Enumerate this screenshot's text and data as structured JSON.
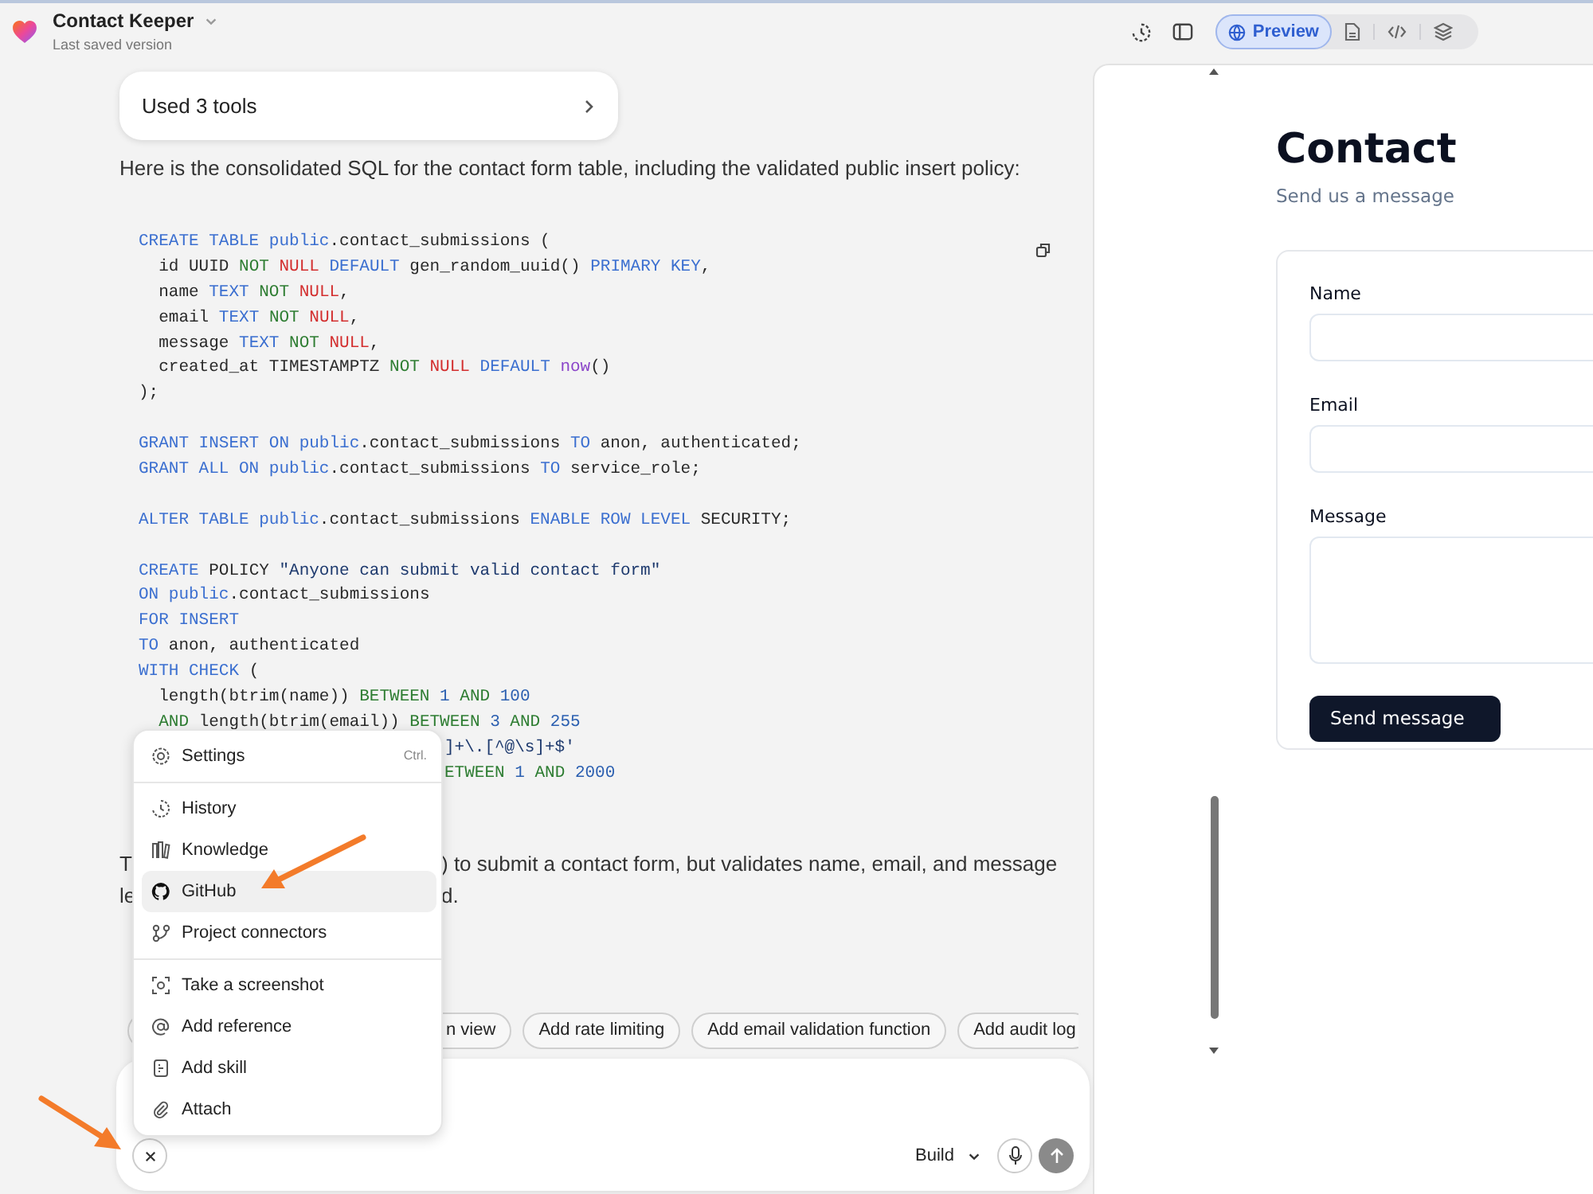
{
  "header": {
    "project_name": "Contact Keeper",
    "subtitle": "Last saved version"
  },
  "view_tabs": [
    {
      "kind": "preview",
      "label": "Preview",
      "selected": true
    },
    {
      "kind": "file",
      "selected": false
    },
    {
      "kind": "code",
      "selected": false
    },
    {
      "kind": "layers",
      "selected": false
    }
  ],
  "chat": {
    "tools_card": "Used 3 tools",
    "intro": "Here is the consolidated SQL for the contact form table, including the validated public insert policy:",
    "code_lines": [
      {
        "kind": "full",
        "tokens": [
          {
            "kind": "keyword",
            "text": "CREATE TABLE public"
          },
          {
            "kind": "plain",
            "text": ".contact_submissions ("
          }
        ]
      },
      {
        "kind": "full",
        "tokens": [
          {
            "kind": "plain",
            "text": "  id UUID "
          },
          {
            "kind": "operator",
            "text": "NOT "
          },
          {
            "kind": "null",
            "text": "NULL "
          },
          {
            "kind": "keyword",
            "text": "DEFAULT "
          },
          {
            "kind": "plain",
            "text": "gen_random_uuid() "
          },
          {
            "kind": "keyword",
            "text": "PRIMARY KEY"
          },
          {
            "kind": "plain",
            "text": ","
          }
        ]
      },
      {
        "kind": "full",
        "tokens": [
          {
            "kind": "plain",
            "text": "  name "
          },
          {
            "kind": "keyword",
            "text": "TEXT "
          },
          {
            "kind": "operator",
            "text": "NOT "
          },
          {
            "kind": "null",
            "text": "NULL"
          },
          {
            "kind": "plain",
            "text": ","
          }
        ]
      },
      {
        "kind": "full",
        "tokens": [
          {
            "kind": "plain",
            "text": "  email "
          },
          {
            "kind": "keyword",
            "text": "TEXT "
          },
          {
            "kind": "operator",
            "text": "NOT "
          },
          {
            "kind": "null",
            "text": "NULL"
          },
          {
            "kind": "plain",
            "text": ","
          }
        ]
      },
      {
        "kind": "full",
        "tokens": [
          {
            "kind": "plain",
            "text": "  message "
          },
          {
            "kind": "keyword",
            "text": "TEXT "
          },
          {
            "kind": "operator",
            "text": "NOT "
          },
          {
            "kind": "null",
            "text": "NULL"
          },
          {
            "kind": "plain",
            "text": ","
          }
        ]
      },
      {
        "kind": "full",
        "tokens": [
          {
            "kind": "plain",
            "text": "  created_at TIMESTAMPTZ "
          },
          {
            "kind": "operator",
            "text": "NOT "
          },
          {
            "kind": "null",
            "text": "NULL "
          },
          {
            "kind": "keyword",
            "text": "DEFAULT "
          },
          {
            "kind": "function",
            "text": "now"
          },
          {
            "kind": "plain",
            "text": "()"
          }
        ]
      },
      {
        "kind": "full",
        "tokens": [
          {
            "kind": "plain",
            "text": ");"
          }
        ]
      },
      {
        "kind": "blank"
      },
      {
        "kind": "full",
        "tokens": [
          {
            "kind": "keyword",
            "text": "GRANT INSERT ON public"
          },
          {
            "kind": "plain",
            "text": ".contact_submissions "
          },
          {
            "kind": "keyword",
            "text": "TO "
          },
          {
            "kind": "plain",
            "text": "anon, authenticated;"
          }
        ]
      },
      {
        "kind": "full",
        "tokens": [
          {
            "kind": "keyword",
            "text": "GRANT ALL ON public"
          },
          {
            "kind": "plain",
            "text": ".contact_submissions "
          },
          {
            "kind": "keyword",
            "text": "TO "
          },
          {
            "kind": "plain",
            "text": "service_role;"
          }
        ]
      },
      {
        "kind": "blank"
      },
      {
        "kind": "full",
        "tokens": [
          {
            "kind": "keyword",
            "text": "ALTER TABLE public"
          },
          {
            "kind": "plain",
            "text": ".contact_submissions "
          },
          {
            "kind": "keyword",
            "text": "ENABLE ROW LEVEL "
          },
          {
            "kind": "plain",
            "text": "SECURITY;"
          }
        ]
      },
      {
        "kind": "blank"
      },
      {
        "kind": "full",
        "tokens": [
          {
            "kind": "keyword",
            "text": "CREATE "
          },
          {
            "kind": "plain",
            "text": "POLICY "
          },
          {
            "kind": "string",
            "text": "\"Anyone can submit valid contact form\""
          }
        ]
      },
      {
        "kind": "full",
        "tokens": [
          {
            "kind": "keyword",
            "text": "ON public"
          },
          {
            "kind": "plain",
            "text": ".contact_submissions"
          }
        ]
      },
      {
        "kind": "full",
        "tokens": [
          {
            "kind": "keyword",
            "text": "FOR INSERT"
          }
        ]
      },
      {
        "kind": "full",
        "tokens": [
          {
            "kind": "keyword",
            "text": "TO "
          },
          {
            "kind": "plain",
            "text": "anon, authenticated"
          }
        ]
      },
      {
        "kind": "full",
        "tokens": [
          {
            "kind": "keyword",
            "text": "WITH CHECK "
          },
          {
            "kind": "plain",
            "text": "("
          }
        ]
      },
      {
        "kind": "full",
        "tokens": [
          {
            "kind": "plain",
            "text": "  length(btrim(name)) "
          },
          {
            "kind": "operator",
            "text": "BETWEEN "
          },
          {
            "kind": "number",
            "text": "1 "
          },
          {
            "kind": "operator",
            "text": "AND "
          },
          {
            "kind": "number",
            "text": "100"
          }
        ]
      },
      {
        "kind": "full",
        "tokens": [
          {
            "kind": "operator",
            "text": "  AND "
          },
          {
            "kind": "plain",
            "text": "length(btrim(email)) "
          },
          {
            "kind": "operator",
            "text": "BETWEEN "
          },
          {
            "kind": "number",
            "text": "3 "
          },
          {
            "kind": "operator",
            "text": "AND "
          },
          {
            "kind": "number",
            "text": "255"
          }
        ]
      },
      {
        "kind": "partial",
        "tokens": [
          {
            "kind": "string",
            "text": "]+\\.[^@\\s]+$'"
          }
        ]
      },
      {
        "kind": "partial",
        "tokens": [
          {
            "kind": "operator",
            "text": "ETWEEN "
          },
          {
            "kind": "number",
            "text": "1 "
          },
          {
            "kind": "operator",
            "text": "AND "
          },
          {
            "kind": "number",
            "text": "2000"
          }
        ]
      }
    ],
    "summary_lines": [
      [
        "T",
        ") to submit a contact form, but validates name, email, and message"
      ],
      [
        "le",
        "d."
      ]
    ],
    "suggestions": [
      "n view",
      "Add rate limiting",
      "Add email validation function",
      "Add audit log"
    ],
    "mode": "Build"
  },
  "menu": {
    "sections": [
      [
        {
          "kind": "settings",
          "label": "Settings",
          "shortcut": "Ctrl.",
          "selected": false
        }
      ],
      [
        {
          "kind": "history",
          "label": "History",
          "selected": false
        },
        {
          "kind": "knowledge",
          "label": "Knowledge",
          "selected": false
        },
        {
          "kind": "github",
          "label": "GitHub",
          "selected": true
        },
        {
          "kind": "connectors",
          "label": "Project connectors",
          "selected": false
        }
      ],
      [
        {
          "kind": "screenshot",
          "label": "Take a screenshot",
          "selected": false
        },
        {
          "kind": "reference",
          "label": "Add reference",
          "selected": false
        },
        {
          "kind": "skill",
          "label": "Add skill",
          "selected": false
        },
        {
          "kind": "attach",
          "label": "Attach",
          "selected": false
        }
      ]
    ]
  },
  "preview": {
    "title": "Contact",
    "subtitle": "Send us a message",
    "fields": [
      {
        "kind": "input",
        "label": "Name"
      },
      {
        "kind": "input",
        "label": "Email"
      },
      {
        "kind": "textarea",
        "label": "Message"
      }
    ],
    "submit": "Send message"
  }
}
